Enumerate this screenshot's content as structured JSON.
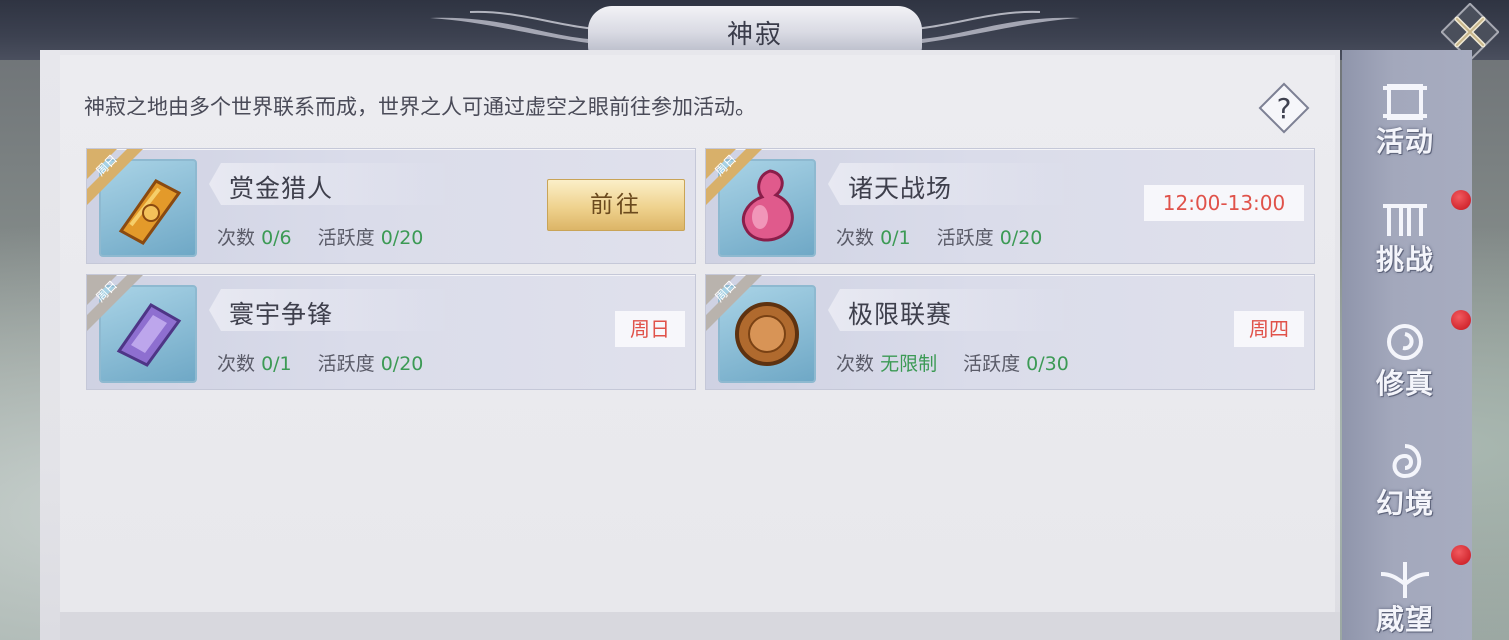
{
  "window": {
    "title": "神寂"
  },
  "intro_text": "神寂之地由多个世界联系而成，世界之人可通过虚空之眼前往参加活动。",
  "help": {
    "label": "?"
  },
  "activities": [
    {
      "name": "赏金猎人",
      "ribbon": "周日",
      "count_label": "次数",
      "count_value": "0/6",
      "activity_label": "活跃度",
      "activity_value": "0/20",
      "action": {
        "type": "button",
        "label": "前往"
      },
      "icon": "golden-scroll-icon"
    },
    {
      "name": "诸天战场",
      "ribbon": "周日",
      "count_label": "次数",
      "count_value": "0/1",
      "activity_label": "活跃度",
      "activity_value": "0/20",
      "action": {
        "type": "time",
        "label": "12:00-13:00"
      },
      "icon": "pink-potion-icon"
    },
    {
      "name": "寰宇争锋",
      "ribbon": "周日",
      "count_label": "次数",
      "count_value": "0/1",
      "activity_label": "活跃度",
      "activity_value": "0/20",
      "action": {
        "type": "day",
        "label": "周日"
      },
      "icon": "purple-crystal-icon"
    },
    {
      "name": "极限联赛",
      "ribbon": "周日",
      "count_label": "次数",
      "count_value": "无限制",
      "activity_label": "活跃度",
      "activity_value": "0/30",
      "action": {
        "type": "day",
        "label": "周四"
      },
      "icon": "bronze-medal-icon"
    }
  ],
  "sidebar": {
    "items": [
      {
        "label": "活动",
        "icon": "scroll-icon",
        "badge": false
      },
      {
        "label": "挑战",
        "icon": "gate-icon",
        "badge": true
      },
      {
        "label": "修真",
        "icon": "swirl-icon",
        "badge": true
      },
      {
        "label": "幻境",
        "icon": "spiral-icon",
        "badge": false
      },
      {
        "label": "威望",
        "icon": "winged-sword-icon",
        "badge": true
      }
    ]
  },
  "colors": {
    "green": "#3c9a55",
    "red": "#e0524a",
    "gold": "#efd28e"
  }
}
